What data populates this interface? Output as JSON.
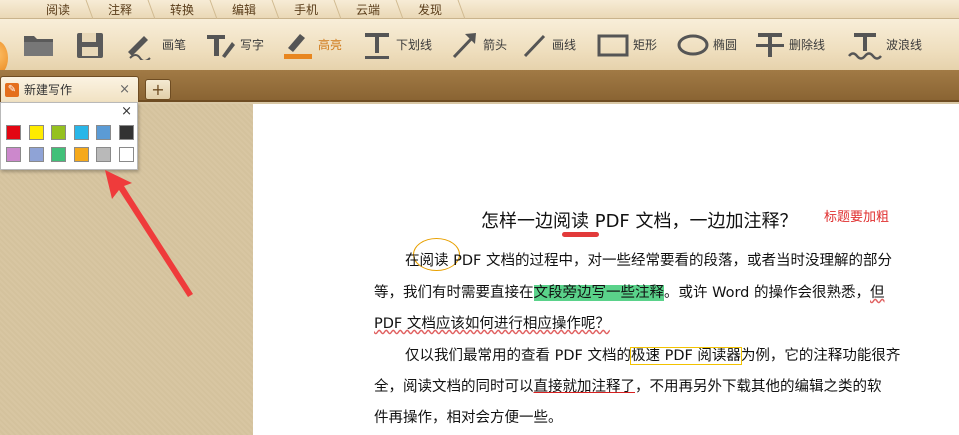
{
  "menu": {
    "tabs": [
      "阅读",
      "注释",
      "转换",
      "编辑",
      "手机",
      "云端",
      "发现"
    ]
  },
  "toolbar": {
    "tools": [
      {
        "icon": "pen-icon",
        "label": "画笔"
      },
      {
        "icon": "typewriter-icon",
        "label": "写字"
      },
      {
        "icon": "highlight-icon",
        "label": "高亮"
      },
      {
        "icon": "underline-icon",
        "label": "下划线"
      },
      {
        "icon": "arrow-icon",
        "label": "箭头"
      },
      {
        "icon": "line-icon",
        "label": "画线"
      },
      {
        "icon": "rectangle-icon",
        "label": "矩形"
      },
      {
        "icon": "ellipse-icon",
        "label": "椭圆"
      },
      {
        "icon": "strikethrough-icon",
        "label": "删除线"
      },
      {
        "icon": "wavy-line-icon",
        "label": "波浪线"
      }
    ],
    "active_tool": "高亮"
  },
  "tabs": {
    "doc_title": "新建写作",
    "close_glyph": "×",
    "new_tab_glyph": "+"
  },
  "palette": {
    "close_glyph": "×",
    "colors": [
      [
        "#e30613",
        "#ffec00",
        "#95c11f",
        "#29b6e8",
        "#5b9bd5",
        "#333333"
      ],
      [
        "#cc88cc",
        "#8fa3d6",
        "#41c079",
        "#f5a91b",
        "#b9b9b9",
        "#ffffff"
      ]
    ]
  },
  "document": {
    "title": "怎样一边阅读 PDF 文档，一边加注释？",
    "title_note": "标题要加粗",
    "lines": {
      "l1": "在阅读 PDF 文档的过程中，对一些经常要看的段落，或者当时没理解的部分",
      "l2_a": "等，我们有时需要直接在",
      "l2_b": "文段旁边写一些注释",
      "l2_c": "。或许 Word 的操作会很熟悉，",
      "l2_d": "但",
      "l3": "PDF 文档应该如何进行相应操作呢？",
      "l4_a": "仅以我们最常用的查看 PDF 文档的",
      "l4_b": "极速 PDF 阅读器",
      "l4_c": "为例，它的注释功能很齐",
      "l5_a": "全，阅读文档的同时可以",
      "l5_b": "直接就加注释了",
      "l5_c": "，不用再另外下载其他的编辑之类的软",
      "l6": "件再操作，相对会方便一些。"
    }
  }
}
